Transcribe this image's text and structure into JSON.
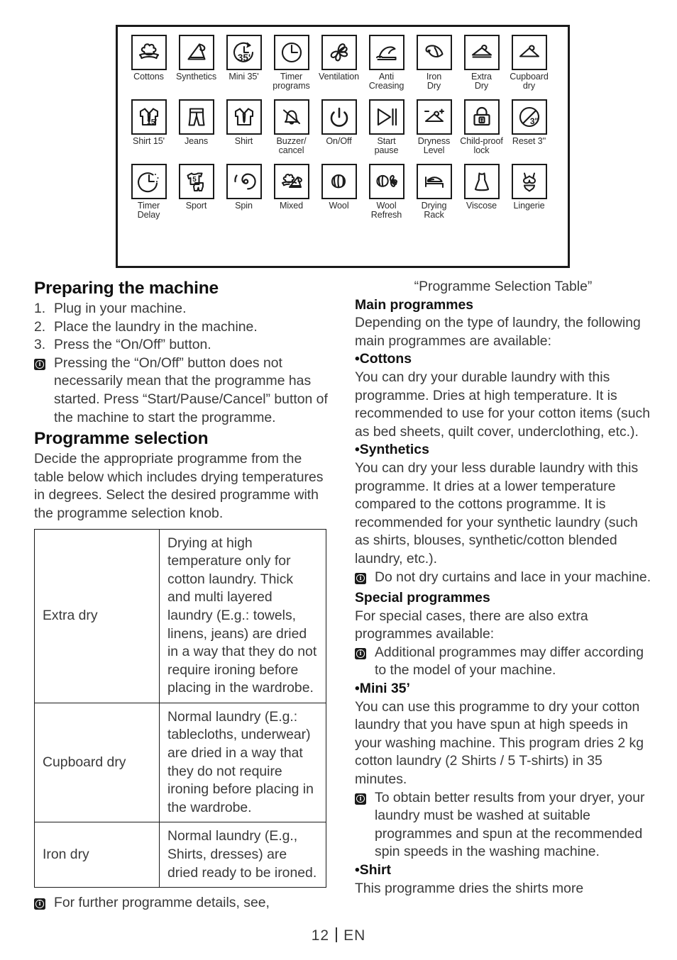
{
  "legend": {
    "rows": [
      [
        {
          "label": "Cottons",
          "icon": "cotton-icon"
        },
        {
          "label": "Synthetics",
          "icon": "synthetics-icon"
        },
        {
          "label": "Mini 35'",
          "icon": "mini35-icon"
        },
        {
          "label": "Timer\nprograms",
          "icon": "timer-programs-icon"
        },
        {
          "label": "Ventilation",
          "icon": "ventilation-icon"
        },
        {
          "label": "Anti\nCreasing",
          "icon": "anti-creasing-icon"
        },
        {
          "label": "Iron\nDry",
          "icon": "iron-dry-icon"
        },
        {
          "label": "Extra\nDry",
          "icon": "extra-dry-icon"
        },
        {
          "label": "Cupboard\ndry",
          "icon": "cupboard-dry-icon"
        }
      ],
      [
        {
          "label": "Shirt 15'",
          "icon": "shirt-15-icon"
        },
        {
          "label": "Jeans",
          "icon": "jeans-icon"
        },
        {
          "label": "Shirt",
          "icon": "shirt-icon"
        },
        {
          "label": "Buzzer/\ncancel",
          "icon": "buzzer-cancel-icon"
        },
        {
          "label": "On/Off",
          "icon": "on-off-icon"
        },
        {
          "label": "Start\npause",
          "icon": "start-pause-icon"
        },
        {
          "label": "Dryness\nLevel",
          "icon": "dryness-level-icon"
        },
        {
          "label": "Child-proof\nlock",
          "icon": "child-proof-lock-icon"
        },
        {
          "label": "Reset 3''",
          "icon": "reset-3-icon"
        }
      ],
      [
        {
          "label": "Timer\nDelay",
          "icon": "timer-delay-icon"
        },
        {
          "label": "Sport",
          "icon": "sport-icon"
        },
        {
          "label": "Spin",
          "icon": "spin-icon"
        },
        {
          "label": "Mixed",
          "icon": "mixed-icon"
        },
        {
          "label": "Wool",
          "icon": "wool-icon"
        },
        {
          "label": "Wool\nRefresh",
          "icon": "wool-refresh-icon"
        },
        {
          "label": "Drying\nRack",
          "icon": "drying-rack-icon"
        },
        {
          "label": "Viscose",
          "icon": "viscose-icon"
        },
        {
          "label": "Lingerie",
          "icon": "lingerie-icon"
        }
      ]
    ]
  },
  "left": {
    "preparing_heading": "Preparing the machine",
    "steps": [
      {
        "num": "1.",
        "text": "Plug in your machine."
      },
      {
        "num": "2.",
        "text": "Place the laundry in the machine."
      },
      {
        "num": "3.",
        "text": "Press the “On/Off” button."
      }
    ],
    "note_onoff": "Pressing the “On/Off” button does not necessarily mean that the programme has started. Press “Start/Pause/Cancel” button of the machine to start the programme.",
    "programme_selection_heading": "Programme selection",
    "programme_selection_body": "Decide the appropriate programme from the table below which includes drying temperatures in degrees. Select the desired programme with the programme selection knob.",
    "table": {
      "rows": [
        {
          "name": "Extra dry",
          "desc": "Drying at high temperature only for cotton laundry. Thick and multi layered laundry (E.g.: towels, linens, jeans) are dried in a way that they do not require ironing before placing in the wardrobe."
        },
        {
          "name": "Cupboard dry",
          "desc": "Normal laundry (E.g.: tablecloths, underwear) are dried in a way that they do not require ironing before placing in the wardrobe."
        },
        {
          "name": "Iron dry",
          "desc": "Normal laundry (E.g., Shirts, dresses) are dried ready to be ironed."
        }
      ]
    },
    "note_further": "For further programme details, see,"
  },
  "right": {
    "table_ref": "“Programme Selection Table”",
    "main_programmes_heading": "Main programmes",
    "main_programmes_body": "Depending on the type of laundry, the following main programmes are available:",
    "cottons_heading": "•Cottons",
    "cottons_body": "You can dry your durable laundry with this programme. Dries at high temperature. It is recommended to use for your cotton items (such as bed sheets, quilt cover, underclothing, etc.).",
    "synthetics_heading": "•Synthetics",
    "synthetics_body": "You can dry your less durable laundry with this programme. It dries at a lower temperature compared to the cottons programme. It is recommended for your synthetic laundry (such as shirts, blouses, synthetic/cotton blended laundry, etc.).",
    "note_curtains": "Do not dry curtains and lace in your machine.",
    "special_programmes_heading": "Special programmes",
    "special_programmes_body": "For special cases, there are also extra programmes available:",
    "note_additional": "Additional programmes may differ according to the model of your machine.",
    "mini35_heading": "•Mini 35’",
    "mini35_body": "You can use this programme to dry your cotton laundry that you have spun at high speeds in your washing machine. This program dries 2 kg cotton laundry (2 Shirts / 5 T-shirts) in 35 minutes.",
    "note_better_results": "To obtain better results from your dryer, your laundry must be washed at suitable programmes and spun at the recommended spin speeds in the washing machine.",
    "shirt_heading": "•Shirt",
    "shirt_body": "This programme dries the shirts more"
  },
  "footer": {
    "page": "12",
    "lang": "EN"
  },
  "colors": {
    "ink": "#1a1a1a",
    "body_text": "#3a3a3a"
  }
}
